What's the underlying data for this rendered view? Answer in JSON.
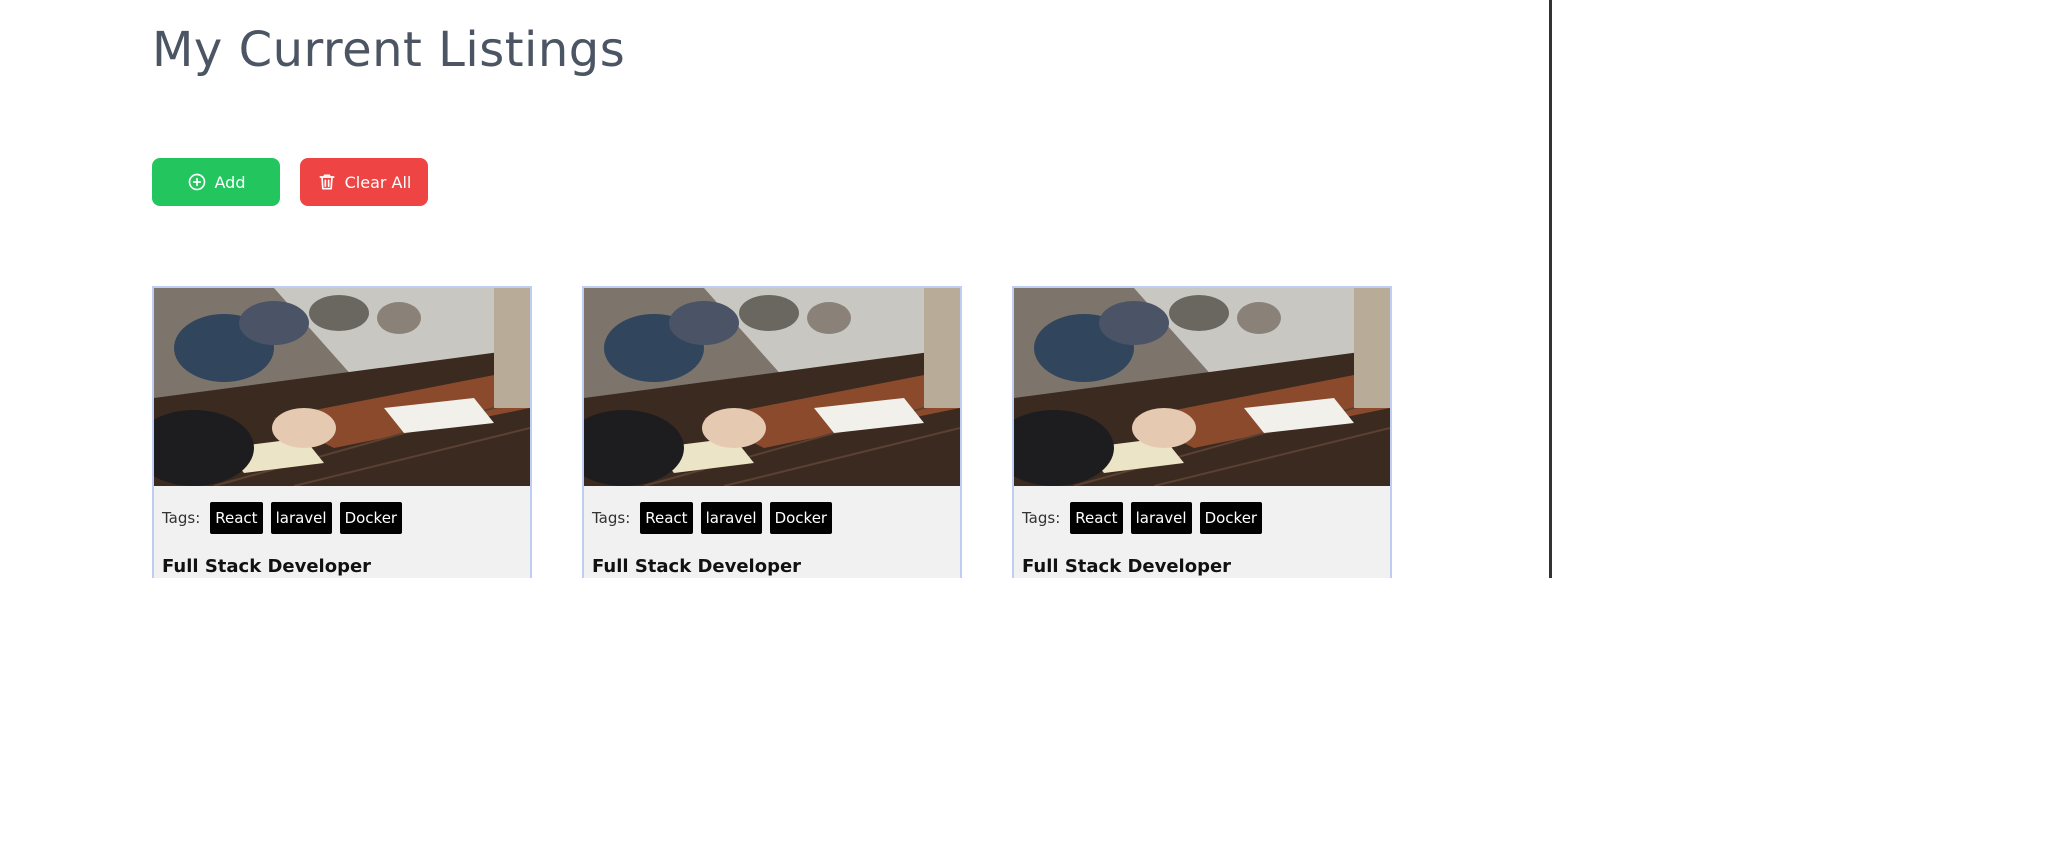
{
  "page": {
    "title": "My Current Listings"
  },
  "toolbar": {
    "add_label": "Add",
    "clear_label": "Clear All",
    "add_icon": "plus-circle-icon",
    "clear_icon": "trash-icon",
    "add_color": "#22c55e",
    "clear_color": "#ef4444"
  },
  "listings": [
    {
      "tags_label": "Tags:",
      "tags": [
        "React",
        "laravel",
        "Docker"
      ],
      "title": "Full Stack Developer"
    },
    {
      "tags_label": "Tags:",
      "tags": [
        "React",
        "laravel",
        "Docker"
      ],
      "title": "Full Stack Developer"
    },
    {
      "tags_label": "Tags:",
      "tags": [
        "React",
        "laravel",
        "Docker"
      ],
      "title": "Full Stack Developer"
    }
  ]
}
